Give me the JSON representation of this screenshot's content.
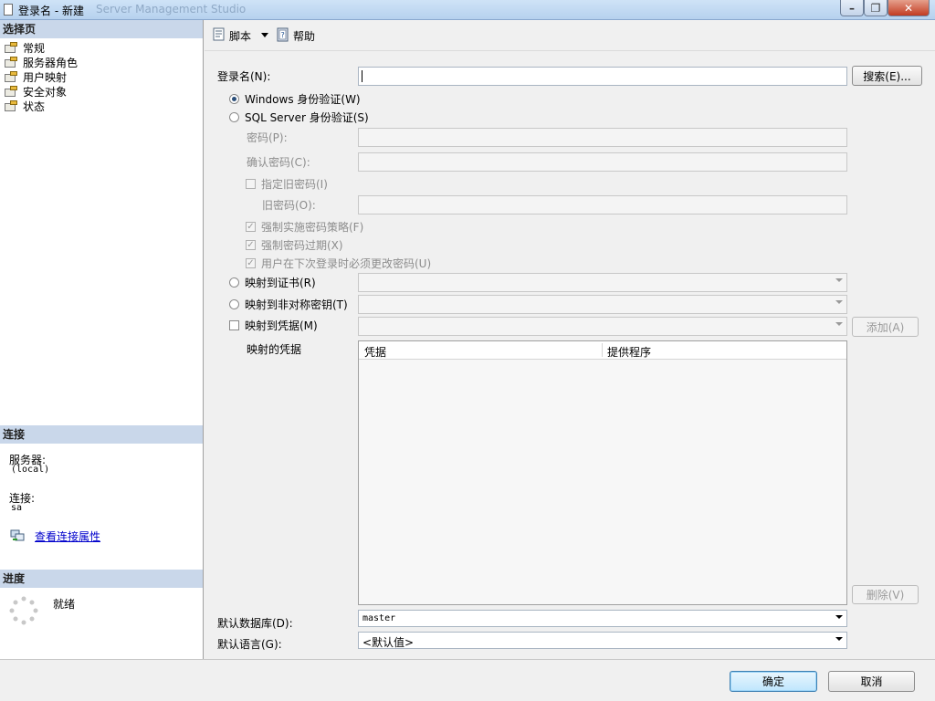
{
  "window": {
    "title": "登录名 - 新建",
    "ghost_title": "Server Management Studio"
  },
  "left": {
    "select_page_header": "选择页",
    "pages": [
      {
        "label": "常规"
      },
      {
        "label": "服务器角色"
      },
      {
        "label": "用户映射"
      },
      {
        "label": "安全对象"
      },
      {
        "label": "状态"
      }
    ],
    "connection_header": "连接",
    "server_label": "服务器:",
    "server_value": "(local)",
    "connection_label": "连接:",
    "connection_value": "sa",
    "view_props_link": "查看连接属性",
    "progress_header": "进度",
    "progress_status": "就绪"
  },
  "toolbar": {
    "script_label": "脚本",
    "help_label": "帮助"
  },
  "form": {
    "login_name_label": "登录名(N):",
    "login_name_value": "",
    "search_button": "搜索(E)...",
    "windows_auth": "Windows 身份验证(W)",
    "sql_auth": "SQL Server 身份验证(S)",
    "password_label": "密码(P):",
    "confirm_password_label": "确认密码(C):",
    "specify_old_password": "指定旧密码(I)",
    "old_password_label": "旧密码(O):",
    "enforce_policy": "强制实施密码策略(F)",
    "enforce_expiration": "强制密码过期(X)",
    "must_change": "用户在下次登录时必须更改密码(U)",
    "map_certificate": "映射到证书(R)",
    "map_asym_key": "映射到非对称密钥(T)",
    "map_credential": "映射到凭据(M)",
    "add_button": "添加(A)",
    "mapped_credentials_label": "映射的凭据",
    "grid_columns": [
      "凭据",
      "提供程序"
    ],
    "remove_button": "删除(V)",
    "default_db_label": "默认数据库(D):",
    "default_db_value": "master",
    "default_lang_label": "默认语言(G):",
    "default_lang_value": "<默认值>"
  },
  "footer": {
    "ok_button": "确定",
    "cancel_button": "取消"
  }
}
